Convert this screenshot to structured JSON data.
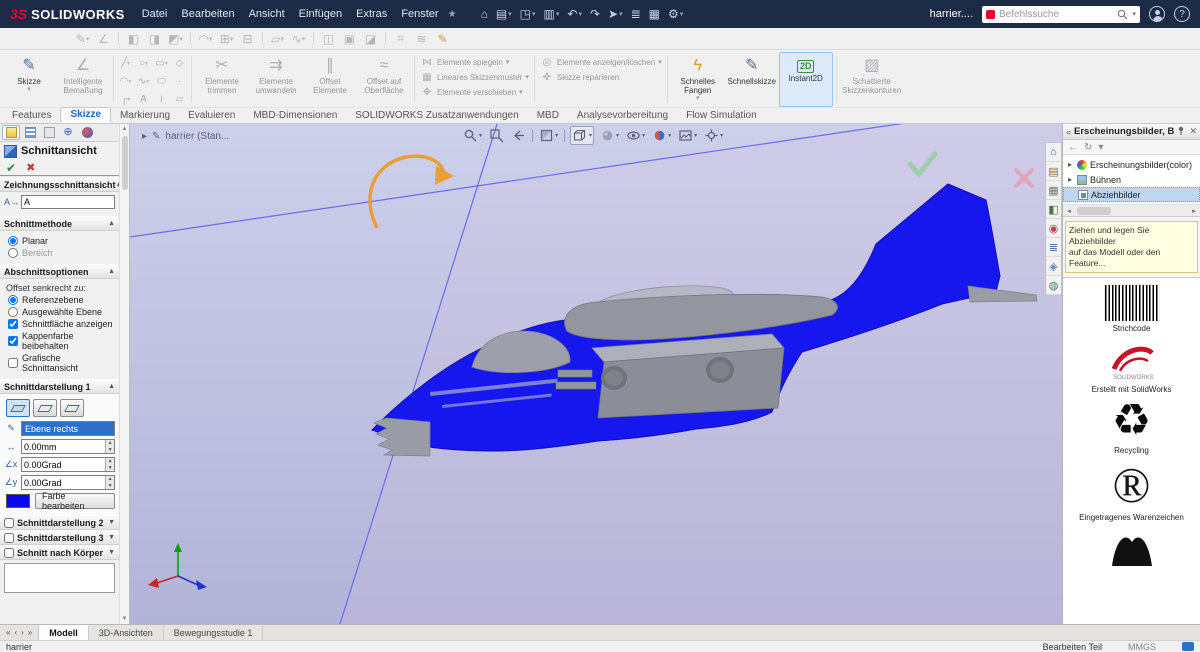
{
  "titlebar": {
    "logo_mark": "3S",
    "logo_text": "SOLIDWORKS",
    "menus": [
      "Datei",
      "Bearbeiten",
      "Ansicht",
      "Einfügen",
      "Extras",
      "Fenster"
    ],
    "doc_label": "harrier....",
    "search_placeholder": "Befehlssuche"
  },
  "ribbon": {
    "buttons": [
      {
        "label": "Skizze"
      },
      {
        "label": "Intelligente Bemaßung"
      },
      {
        "label": "Elemente trimmen"
      },
      {
        "label": "Elemente umwandeln"
      },
      {
        "label": "Offset Elemente"
      },
      {
        "label": "Offset auf Oberfläche"
      },
      {
        "label": "Elemente spiegeln"
      },
      {
        "label": "Lineares Skizzenmuster"
      },
      {
        "label": "Elemente verschieben"
      },
      {
        "label": "Elemente anzeigen/löschen"
      },
      {
        "label": "Skizze reparieren"
      },
      {
        "label": "Schnelles Fangen"
      },
      {
        "label": "Schnellskizze"
      },
      {
        "label": "Instant2D"
      },
      {
        "label": "Schattierte Skizzenkonturen"
      }
    ]
  },
  "command_tabs": [
    "Features",
    "Skizze",
    "Markierung",
    "Evaluieren",
    "MBD-Dimensionen",
    "SOLIDWORKS Zusatzanwendungen",
    "MBD",
    "Analysevorbereitung",
    "Flow Simulation"
  ],
  "property_panel": {
    "title": "Schnittansicht",
    "drawing_section": {
      "header": "Zeichnungsschnittansicht",
      "value": "A"
    },
    "method": {
      "header": "Schnittmethode",
      "planar_label": "Planar",
      "bereich_label": "Bereich",
      "planar_checked": true,
      "bereich_checked": false
    },
    "options": {
      "header": "Abschnittsoptionen",
      "offset_label": "Offset senkrecht zu:",
      "ref_label": "Referenzebene",
      "ref_checked": true,
      "sel_label": "Ausgewählte Ebene",
      "sel_checked": false,
      "chk1_label": "Schnittfläche anzeigen",
      "chk1_checked": true,
      "chk2_label": "Kappenfarbe beibehalten",
      "chk2_checked": true,
      "chk3_label": "Grafische Schnittansicht",
      "chk3_checked": false
    },
    "section1": {
      "header": "Schnittdarstellung 1",
      "reference": "Ebene rechts",
      "offset_value": "0.00mm",
      "rot1_value": "0.00Grad",
      "rot2_value": "0.00Grad",
      "color": "#0909f0",
      "edit_color_label": "Farbe bearbeiten"
    },
    "section2": {
      "header": "Schnittdarstellung 2",
      "checked": false
    },
    "section3": {
      "header": "Schnittdarstellung 3",
      "checked": false
    },
    "per_body": {
      "header": "Schnitt nach Körper",
      "checked": false
    }
  },
  "viewport": {
    "breadcrumb": "harrier  (Stan..."
  },
  "task_pane": {
    "title": "Erscheinungsbilder, Büh",
    "tree": [
      {
        "label": "Erscheinungsbilder(color)"
      },
      {
        "label": "Bühnen"
      },
      {
        "label": "Abziehbilder"
      }
    ],
    "tooltip_line1": "Ziehen und legen Sie Abziehbilder",
    "tooltip_line2": "auf das Modell oder den Feature...",
    "decals": [
      {
        "label": "Strichcode"
      },
      {
        "label": "Erstellt mit SolidWorks"
      },
      {
        "label": "Recycling"
      },
      {
        "label": "Eingetragenes Warenzeichen"
      }
    ]
  },
  "bottom_tabs": [
    "Modell",
    "3D-Ansichten",
    "Bewegungsstudie 1"
  ],
  "statusbar": {
    "document": "harrier",
    "mode": "Bearbeiten Teil",
    "units": "MMGS"
  },
  "colors": {
    "accent_blue": "#0909f0",
    "selection": "#2e6fca",
    "titlebar": "#1c2b45"
  }
}
